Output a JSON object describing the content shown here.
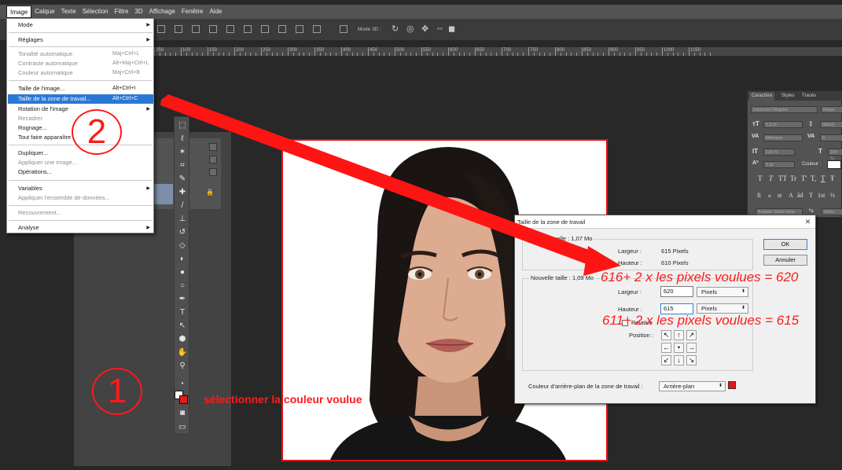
{
  "menubar": {
    "items": [
      "Image",
      "Calque",
      "Texte",
      "Sélection",
      "Filtre",
      "3D",
      "Affichage",
      "Fenêtre",
      "Aide"
    ],
    "active": "Image"
  },
  "options_bar": {
    "mode3d_label": "Mode 3D :"
  },
  "ruler_top": {
    "labels": [
      "250",
      "100",
      "150",
      "200",
      "250",
      "300",
      "350",
      "400",
      "450",
      "500",
      "550",
      "600",
      "650",
      "700",
      "750",
      "800",
      "850",
      "900",
      "950",
      "1000",
      "1050"
    ]
  },
  "image_menu": {
    "items": [
      {
        "label": "Mode",
        "submenu": true,
        "disabled": false
      },
      {
        "label": "Réglages",
        "submenu": true,
        "disabled": false
      },
      {
        "label": "Tonalité automatique",
        "shortcut": "Maj+Ctrl+L",
        "disabled": true
      },
      {
        "label": "Contraste automatique",
        "shortcut": "Alt+Maj+Ctrl+L",
        "disabled": true
      },
      {
        "label": "Couleur automatique",
        "shortcut": "Maj+Ctrl+B",
        "disabled": true
      },
      {
        "label": "Taille de l'image...",
        "shortcut": "Alt+Ctrl+I",
        "disabled": false
      },
      {
        "label": "Taille de la zone de travail...",
        "shortcut": "Alt+Ctrl+C",
        "disabled": false,
        "highlighted": true
      },
      {
        "label": "Rotation de l'image",
        "submenu": true,
        "disabled": false
      },
      {
        "label": "Recadrer",
        "disabled": true
      },
      {
        "label": "Rognage...",
        "disabled": false
      },
      {
        "label": "Tout faire apparaître",
        "disabled": false
      },
      {
        "label": "Dupliquer...",
        "disabled": false
      },
      {
        "label": "Appliquer une image...",
        "disabled": true
      },
      {
        "label": "Opérations...",
        "disabled": false
      },
      {
        "label": "Variables",
        "submenu": true,
        "disabled": false
      },
      {
        "label": "Appliquer l'ensemble de données...",
        "disabled": true
      },
      {
        "label": "Recouvrement...",
        "disabled": true
      },
      {
        "label": "Analyse",
        "submenu": true,
        "disabled": false
      }
    ]
  },
  "char_panel": {
    "tabs": [
      "Caractère",
      "Styles",
      "Tracés"
    ],
    "font_family": "Imperator Regular",
    "font_style": "Regul",
    "size": "0,2 pt",
    "leading": "(Auto)",
    "kerning": "Métrique",
    "tracking": "0",
    "vscale": "100 %",
    "hscale": "100 %",
    "baseline": "0 pt",
    "color_label": "Couleur :",
    "language": "Anglais: Etats-Unis",
    "aa": "Nette",
    "styles_row": [
      "T",
      "T",
      "TT",
      "Tr",
      "T'",
      "T,",
      "T",
      "Ŧ"
    ],
    "opentype_row": [
      "fi",
      "ℴ",
      "st",
      "A",
      "ād",
      "T",
      "1st",
      "½"
    ]
  },
  "dialog": {
    "title": "Taille de la zone de travail",
    "current_size_label": "Taille actuelle : 1,07 Mo",
    "current_width_label": "Largeur :",
    "current_width_value": "615 Pixels",
    "current_height_label": "Hauteur :",
    "current_height_value": "610 Pixels",
    "new_size_label": "Nouvelle taille : 1,09 Mo",
    "width_label": "Largeur :",
    "width_value": "620",
    "width_unit": "Pixels",
    "height_label": "Hauteur :",
    "height_value": "615",
    "height_unit": "Pixels",
    "relative_label": "Relative",
    "position_label": "Position :",
    "anchors": [
      "↖",
      "↑",
      "↗",
      "←",
      "•",
      "→",
      "↙",
      "↓",
      "↘"
    ],
    "bg_color_label": "Couleur d'arrière-plan de la zone de travail :",
    "bg_color_value": "Arrière-plan",
    "ok_label": "OK",
    "cancel_label": "Annuler"
  },
  "annotations": {
    "step1": "1",
    "step2": "2",
    "select_color_note": "sélectionner la couleur voulue",
    "width_formula": "616+ 2 x les pixels voulues = 620",
    "height_formula": "611+ 2 x les pixels voulues = 615"
  },
  "colors": {
    "accent_red": "#ff1a1a",
    "menu_highlight": "#2a78d6",
    "foreground_color": "#ffffff",
    "background_color": "#e21b1b"
  }
}
